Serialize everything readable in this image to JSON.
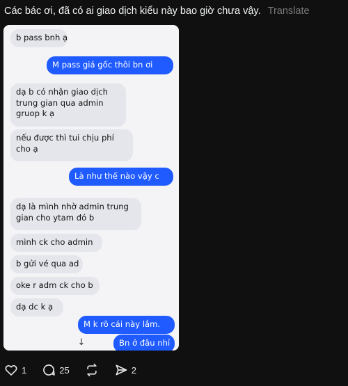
{
  "post": {
    "caption": "Các bác ơi, đã có ai giao dịch kiểu này bao giờ chưa vậy.",
    "translate_label": "Translate"
  },
  "chat": {
    "messages": [
      {
        "side": "in",
        "text": "b pass bnh ạ"
      },
      {
        "side": "out",
        "text": "M pass giá gốc thôi bn ơi"
      },
      {
        "side": "in",
        "text": "dạ b có nhận giao dịch\ntrung gian qua admin\ngruop k ạ"
      },
      {
        "side": "in",
        "text": "nếu được thì tui chịu phí\ncho ạ"
      },
      {
        "side": "out",
        "text": "Là như thế nào vậy c"
      },
      {
        "side": "in",
        "text": "dạ là mình nhờ admin trung\ngian cho ytam đó b"
      },
      {
        "side": "in",
        "text": "mình ck cho admin"
      },
      {
        "side": "in",
        "text": "b gửi vé qua ad"
      },
      {
        "side": "in",
        "text": "oke r adm ck cho b"
      },
      {
        "side": "in",
        "text": "dạ dc k ạ"
      },
      {
        "side": "out",
        "text": "M k rõ cái này lắm."
      },
      {
        "side": "out",
        "text": "Bn ở đâu nhỉ"
      }
    ],
    "scroll_icon": "arrow-down-icon",
    "scroll_glyph": "↓"
  },
  "actions": {
    "like": {
      "icon": "heart-icon",
      "count": "1"
    },
    "reply": {
      "icon": "comment-icon",
      "count": "25"
    },
    "repost": {
      "icon": "repost-icon",
      "count": ""
    },
    "share": {
      "icon": "send-icon",
      "count": "2"
    }
  }
}
